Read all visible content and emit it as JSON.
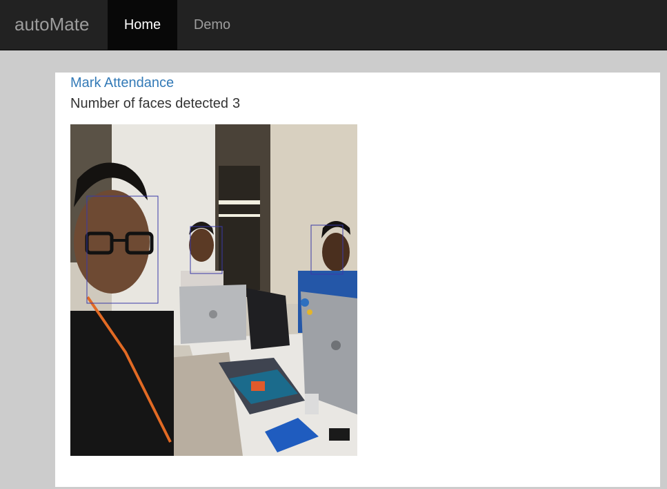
{
  "navbar": {
    "brand": "autoMate",
    "items": [
      {
        "label": "Home",
        "active": true
      },
      {
        "label": "Demo",
        "active": false
      }
    ]
  },
  "main": {
    "link_label": "Mark Attendance",
    "faces_label": "Number of faces detected",
    "faces_count": "3"
  },
  "colors": {
    "navbar_bg": "#222222",
    "active_tab_bg": "#080808",
    "link": "#337ab7",
    "page_bg": "#cccccc",
    "face_box": "#3a3aa8"
  }
}
